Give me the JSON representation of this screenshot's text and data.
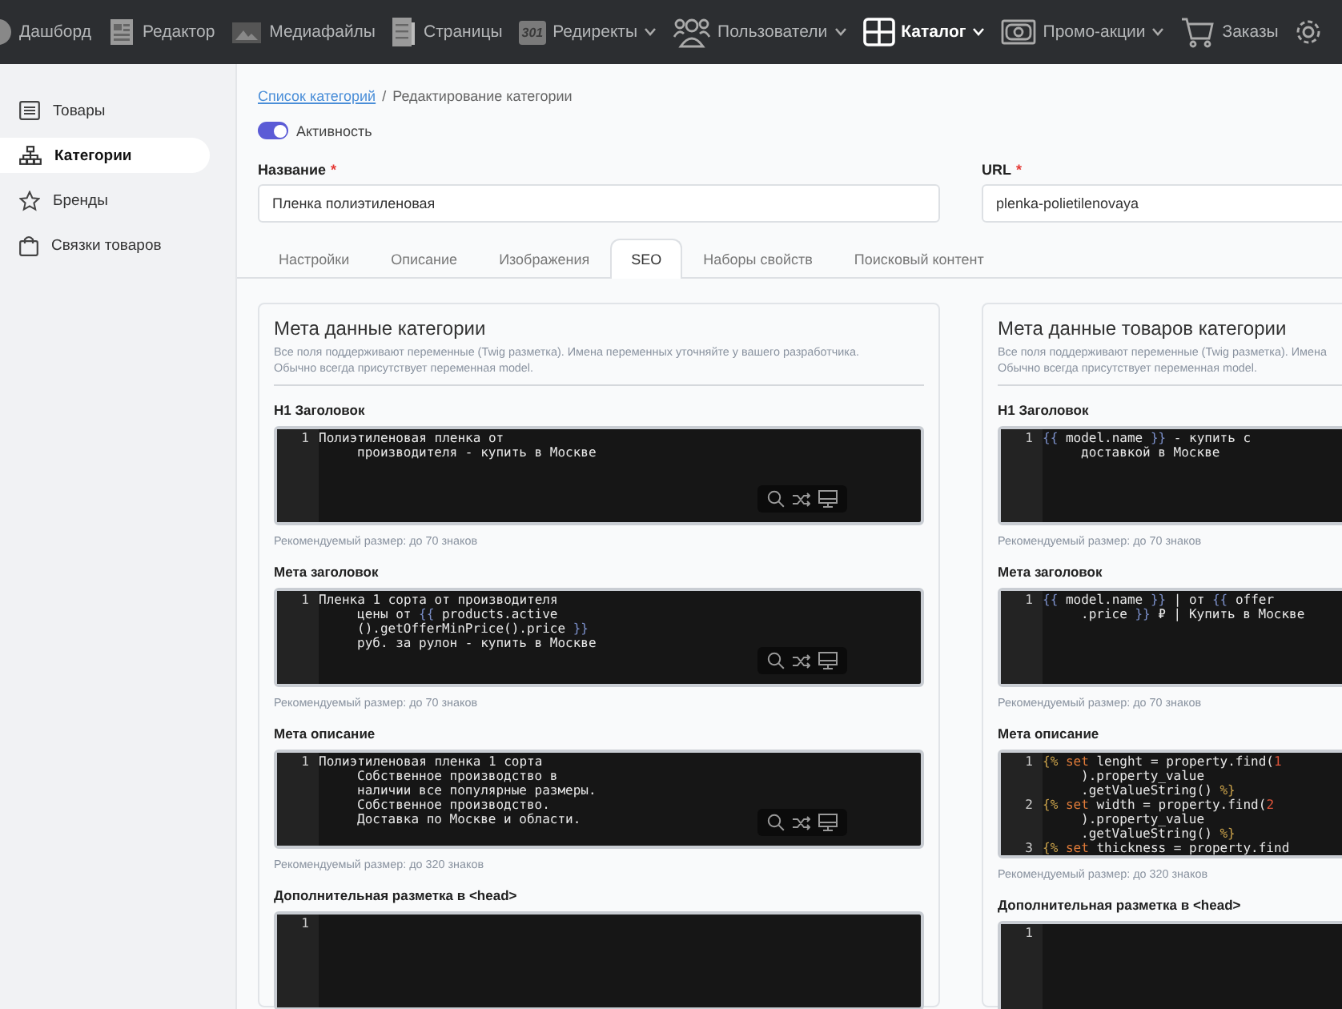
{
  "nav": {
    "items": [
      {
        "label": "Дашборд",
        "selected": false,
        "dropdown": false
      },
      {
        "label": "Редактор",
        "selected": false,
        "dropdown": false
      },
      {
        "label": "Медиафайлы",
        "selected": false,
        "dropdown": false
      },
      {
        "label": "Страницы",
        "selected": false,
        "dropdown": false
      },
      {
        "label": "Редиректы",
        "badge": "301",
        "selected": false,
        "dropdown": true
      },
      {
        "label": "Пользователи",
        "selected": false,
        "dropdown": true
      },
      {
        "label": "Каталог",
        "selected": true,
        "dropdown": true
      },
      {
        "label": "Промо-акции",
        "selected": false,
        "dropdown": true
      },
      {
        "label": "Заказы",
        "selected": false,
        "dropdown": false
      }
    ]
  },
  "sidebar": {
    "items": [
      {
        "label": "Товары",
        "selected": false
      },
      {
        "label": "Категории",
        "selected": true
      },
      {
        "label": "Бренды",
        "selected": false
      },
      {
        "label": "Связки товаров",
        "selected": false
      }
    ]
  },
  "breadcrumb": {
    "link": "Список категорий",
    "separator": "/",
    "current": "Редактирование категории"
  },
  "active_toggle": {
    "label": "Активность",
    "on": true
  },
  "fields": [
    {
      "label": "Название",
      "required_mark": "*",
      "value": "Пленка полиэтиленовая"
    },
    {
      "label": "URL",
      "required_mark": "*",
      "value": "plenka-polietilenovaya"
    }
  ],
  "tabs": [
    {
      "label": "Настройки",
      "selected": false
    },
    {
      "label": "Описание",
      "selected": false
    },
    {
      "label": "Изображения",
      "selected": false
    },
    {
      "label": "SEO",
      "selected": true
    },
    {
      "label": "Наборы свойств",
      "selected": false
    },
    {
      "label": "Поисковый контент",
      "selected": false
    }
  ],
  "panels": [
    {
      "title": "Мета данные категории",
      "description": [
        "Все поля поддерживают переменные (Twig разметка). Имена переменных уточняйте у вашего разработчика.",
        "Обычно всегда присутствует переменная model."
      ],
      "fields": [
        {
          "label": "H1 Заголовок",
          "hint": "Рекомендуемый размер: до 70 знаков",
          "toolbar": true,
          "lines": [
            {
              "number": "1",
              "rows": [
                {
                  "segments": [
                    {
                      "kind": "text",
                      "text": "Полиэтиленовая пленка от"
                    }
                  ]
                },
                {
                  "segments": [
                    {
                      "kind": "text",
                      "text": "производителя - купить в Москве"
                    }
                  ]
                }
              ]
            }
          ]
        },
        {
          "label": "Мета заголовок",
          "hint": "Рекомендуемый размер: до 70 знаков",
          "toolbar": true,
          "lines": [
            {
              "number": "1",
              "rows": [
                {
                  "segments": [
                    {
                      "kind": "text",
                      "text": "Пленка 1 сорта от производителя"
                    }
                  ]
                },
                {
                  "segments": [
                    {
                      "kind": "text",
                      "text": "цены от "
                    },
                    {
                      "kind": "twig",
                      "text": "{{"
                    },
                    {
                      "kind": "text",
                      "text": " products.active"
                    }
                  ]
                },
                {
                  "segments": [
                    {
                      "kind": "text",
                      "text": "().getOfferMinPrice().price "
                    },
                    {
                      "kind": "twig",
                      "text": "}}"
                    }
                  ]
                },
                {
                  "segments": [
                    {
                      "kind": "text",
                      "text": "руб. за рулон - купить в Москве"
                    }
                  ]
                }
              ]
            }
          ]
        },
        {
          "label": "Мета описание",
          "hint": "Рекомендуемый размер: до 320 знаков",
          "toolbar": true,
          "lines": [
            {
              "number": "1",
              "rows": [
                {
                  "segments": [
                    {
                      "kind": "text",
                      "text": "Полиэтиленовая пленка 1 сорта"
                    }
                  ]
                },
                {
                  "segments": [
                    {
                      "kind": "text",
                      "text": "Собственное производство в"
                    }
                  ]
                },
                {
                  "segments": [
                    {
                      "kind": "text",
                      "text": "наличии все популярные размеры."
                    }
                  ]
                },
                {
                  "segments": [
                    {
                      "kind": "text",
                      "text": "Собственное производство."
                    }
                  ]
                },
                {
                  "segments": [
                    {
                      "kind": "text",
                      "text": "Доставка по Москве и области."
                    }
                  ]
                }
              ]
            }
          ]
        },
        {
          "label": "Дополнительная разметка в <head>",
          "toolbar": false,
          "lines": [
            {
              "number": "1"
            }
          ]
        }
      ]
    },
    {
      "title": "Мета данные товаров категории",
      "description": [
        "Все поля поддерживают переменные (Twig разметка). Имена",
        "Обычно всегда присутствует переменная model."
      ],
      "fields": [
        {
          "label": "H1 Заголовок",
          "hint": "Рекомендуемый размер: до 70 знаков",
          "toolbar": false,
          "lines": [
            {
              "number": "1",
              "rows": [
                {
                  "segments": [
                    {
                      "kind": "twig",
                      "text": "{{"
                    },
                    {
                      "kind": "text",
                      "text": " model.name "
                    },
                    {
                      "kind": "twig",
                      "text": "}}"
                    },
                    {
                      "kind": "text",
                      "text": " - купить с"
                    }
                  ]
                },
                {
                  "segments": [
                    {
                      "kind": "text",
                      "text": "доставкой в Москве"
                    }
                  ]
                }
              ]
            }
          ]
        },
        {
          "label": "Мета заголовок",
          "hint": "Рекомендуемый размер: до 70 знаков",
          "toolbar": false,
          "lines": [
            {
              "number": "1",
              "rows": [
                {
                  "segments": [
                    {
                      "kind": "twig",
                      "text": "{{"
                    },
                    {
                      "kind": "text",
                      "text": " model.name "
                    },
                    {
                      "kind": "twig",
                      "text": "}}"
                    },
                    {
                      "kind": "text",
                      "text": " | от "
                    },
                    {
                      "kind": "twig",
                      "text": "{{"
                    },
                    {
                      "kind": "text",
                      "text": " offer"
                    }
                  ]
                },
                {
                  "segments": [
                    {
                      "kind": "text",
                      "text": ".price "
                    },
                    {
                      "kind": "twig",
                      "text": "}}"
                    },
                    {
                      "kind": "text",
                      "text": " ₽ | Купить в Москве"
                    }
                  ]
                }
              ]
            }
          ]
        },
        {
          "label": "Мета описание",
          "hint": "Рекомендуемый размер: до 320 знаков",
          "toolbar": false,
          "lines": [
            {
              "number": "1",
              "rows": [
                {
                  "segments": [
                    {
                      "kind": "tag",
                      "text": "{%"
                    },
                    {
                      "kind": "keyword",
                      "text": " set"
                    },
                    {
                      "kind": "text",
                      "text": " lenght = property.find("
                    },
                    {
                      "kind": "number",
                      "text": "1"
                    }
                  ]
                },
                {
                  "segments": [
                    {
                      "kind": "text",
                      "text": ").property_value"
                    }
                  ]
                },
                {
                  "segments": [
                    {
                      "kind": "text",
                      "text": ".getValueString() "
                    },
                    {
                      "kind": "tag",
                      "text": "%}"
                    }
                  ]
                }
              ]
            },
            {
              "number": "2",
              "rows": [
                {
                  "segments": [
                    {
                      "kind": "tag",
                      "text": "{%"
                    },
                    {
                      "kind": "keyword",
                      "text": " set"
                    },
                    {
                      "kind": "text",
                      "text": " width = property.find("
                    },
                    {
                      "kind": "number",
                      "text": "2"
                    }
                  ]
                },
                {
                  "segments": [
                    {
                      "kind": "text",
                      "text": ").property_value"
                    }
                  ]
                },
                {
                  "segments": [
                    {
                      "kind": "text",
                      "text": ".getValueString() "
                    },
                    {
                      "kind": "tag",
                      "text": "%}"
                    }
                  ]
                }
              ]
            },
            {
              "number": "3",
              "rows": [
                {
                  "segments": [
                    {
                      "kind": "tag",
                      "text": "{%"
                    },
                    {
                      "kind": "keyword",
                      "text": " set"
                    },
                    {
                      "kind": "text",
                      "text": " thickness = property.find"
                    }
                  ]
                }
              ]
            }
          ]
        },
        {
          "label": "Дополнительная разметка в <head>",
          "toolbar": false,
          "lines": [
            {
              "number": "1"
            }
          ]
        }
      ]
    }
  ]
}
